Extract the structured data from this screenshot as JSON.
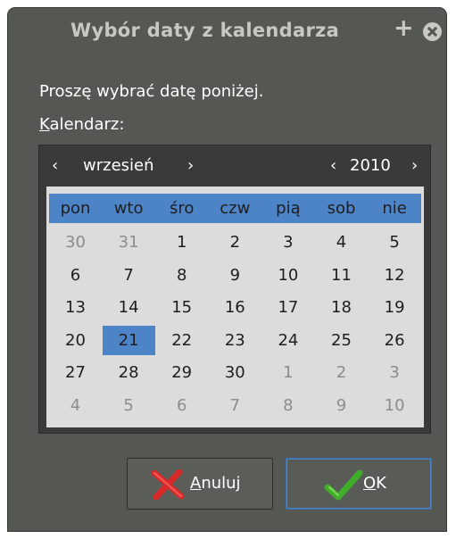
{
  "window": {
    "title": "Wybór daty z kalendarza",
    "plus_glyph": "+",
    "close_icon": "close-icon"
  },
  "prompt": "Proszę wybrać datę poniżej.",
  "calendar_label": {
    "accel": "K",
    "rest": "alendarz:"
  },
  "calendar": {
    "month_prev": "‹",
    "month": "wrzesień",
    "month_next": "›",
    "year_prev": "‹",
    "year": "2010",
    "year_next": "›",
    "weekdays": [
      "pon",
      "wto",
      "śro",
      "czw",
      "pią",
      "sob",
      "nie"
    ],
    "rows": [
      [
        "30",
        "31",
        "1",
        "2",
        "3",
        "4",
        "5"
      ],
      [
        "6",
        "7",
        "8",
        "9",
        "10",
        "11",
        "12"
      ],
      [
        "13",
        "14",
        "15",
        "16",
        "17",
        "18",
        "19"
      ],
      [
        "20",
        "21",
        "22",
        "23",
        "24",
        "25",
        "26"
      ],
      [
        "27",
        "28",
        "29",
        "30",
        "1",
        "2",
        "3"
      ],
      [
        "4",
        "5",
        "6",
        "7",
        "8",
        "9",
        "10"
      ]
    ],
    "selected_day": "21",
    "accent": "#4d84c8"
  },
  "buttons": {
    "cancel": {
      "accel": "A",
      "rest": "nuluj",
      "icon": "red-x-icon"
    },
    "ok": {
      "accel": "O",
      "rest": "K",
      "icon": "green-check-icon"
    }
  }
}
